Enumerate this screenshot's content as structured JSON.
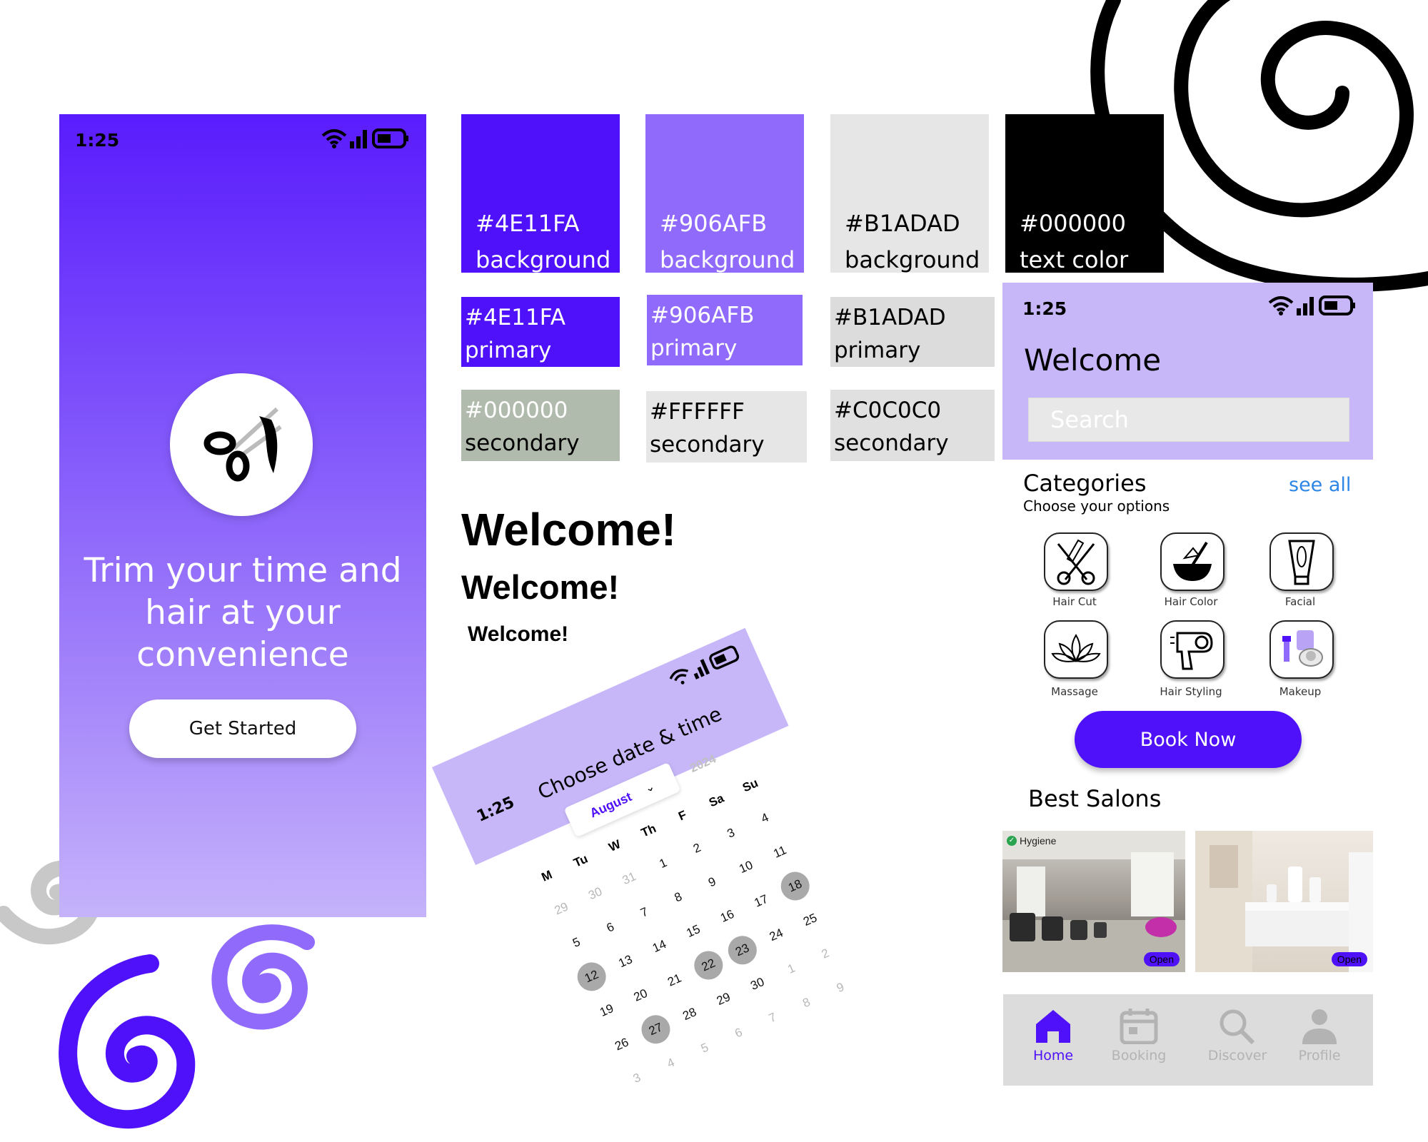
{
  "phone_onboarding": {
    "time": "1:25",
    "tagline_line1": "Trim your time and",
    "tagline_line2": "hair at your",
    "tagline_line3": "convenience",
    "cta_label": "Get Started"
  },
  "palette": [
    {
      "hex": "#4E11FA",
      "role": "background",
      "color": "#4e11fa"
    },
    {
      "hex": "#906AFB",
      "role": "background",
      "color": "#906afb"
    },
    {
      "hex": "#B1ADAD",
      "role": "background",
      "color": "#e6e6e6"
    },
    {
      "hex": "#000000",
      "role": "text color",
      "color": "#000000"
    },
    {
      "hex": "#4E11FA",
      "role": "primary",
      "color": "#4e11fa"
    },
    {
      "hex": "#906AFB",
      "role": "primary",
      "color": "#906afb"
    },
    {
      "hex": "#B1ADAD",
      "role": "primary",
      "color": "#dcdcdc"
    },
    {
      "hex": "#000000",
      "role": "secondary",
      "color": "#b1bbad"
    },
    {
      "hex": "#FFFFFF",
      "role": "secondary",
      "color": "#e6e6e6"
    },
    {
      "hex": "#C0C0C0",
      "role": "secondary",
      "color": "#e0e0e0"
    }
  ],
  "typography": {
    "heading1": "Welcome!",
    "heading2": "Welcome!",
    "heading3": "Welcome!"
  },
  "phone_calendar": {
    "time": "1:25",
    "title": "Choose date & time",
    "month": "August",
    "year": "2024",
    "weekdays": [
      "M",
      "Tu",
      "W",
      "Th",
      "F",
      "Sa",
      "Su"
    ],
    "weeks": [
      [
        "29",
        "30",
        "31",
        "1",
        "2",
        "3",
        "4"
      ],
      [
        "5",
        "6",
        "7",
        "8",
        "9",
        "10",
        "11"
      ],
      [
        "12",
        "13",
        "14",
        "15",
        "16",
        "17",
        "18"
      ],
      [
        "19",
        "20",
        "21",
        "22",
        "23",
        "24",
        "25"
      ],
      [
        "26",
        "27",
        "28",
        "29",
        "30",
        "1",
        "2"
      ],
      [
        "3",
        "4",
        "5",
        "6",
        "7",
        "8",
        "9"
      ]
    ],
    "highlighted": [
      "12",
      "18",
      "22",
      "23",
      "27"
    ]
  },
  "phone_home": {
    "time": "1:25",
    "welcome": "Welcome",
    "search_placeholder": "Search",
    "categories_title": "Categories",
    "categories_subtitle": "Choose your options",
    "see_all": "see all",
    "categories": [
      {
        "label": "Hair Cut",
        "icon": "scissors-comb-icon"
      },
      {
        "label": "Hair Color",
        "icon": "hair-dye-bowl-icon"
      },
      {
        "label": "Facial",
        "icon": "cream-tube-icon"
      },
      {
        "label": "Massage",
        "icon": "lotus-icon"
      },
      {
        "label": "Hair Styling",
        "icon": "hair-dryer-icon"
      },
      {
        "label": "Makeup",
        "icon": "makeup-kit-icon"
      }
    ],
    "book_now": "Book Now",
    "best_salons": "Best Salons",
    "salons": [
      {
        "badge": "Hygiene",
        "status": "Open"
      },
      {
        "badge": "",
        "status": "Open"
      }
    ],
    "nav": [
      {
        "label": "Home",
        "icon": "home-icon"
      },
      {
        "label": "Booking",
        "icon": "calendar-icon"
      },
      {
        "label": "Discover",
        "icon": "search-icon"
      },
      {
        "label": "Profile",
        "icon": "user-icon"
      }
    ]
  }
}
